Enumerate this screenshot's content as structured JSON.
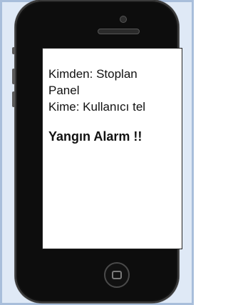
{
  "message": {
    "from_line_1": "Kimden: Stoplan",
    "from_line_2": "Panel",
    "to_line": "Kime: Kullanıcı tel",
    "alert_text": "Yangın Alarm !!"
  },
  "colors": {
    "background": "#dfe9f6",
    "phone_body": "#0d0d0d",
    "screen": "#ffffff",
    "text": "#111111"
  },
  "icons": {
    "home_button": "home-button-icon",
    "camera": "camera-icon",
    "speaker": "speaker-icon"
  }
}
